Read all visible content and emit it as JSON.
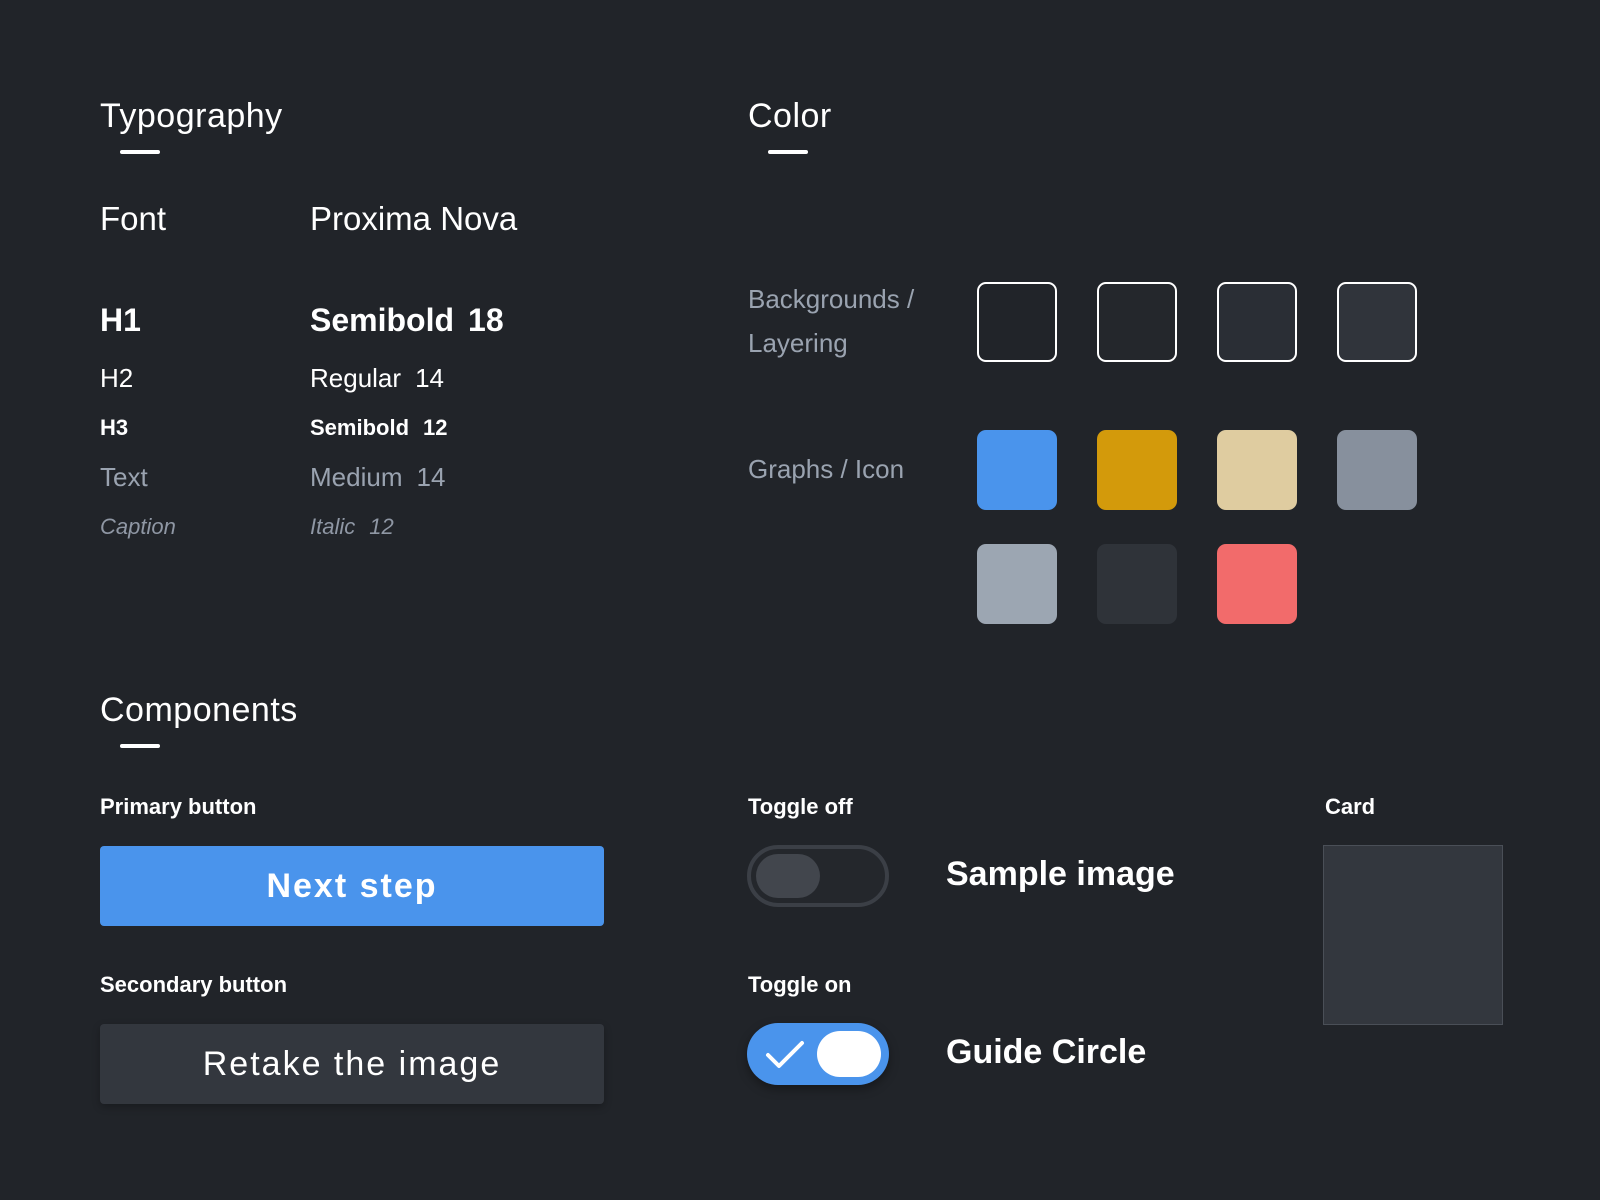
{
  "typography": {
    "title": "Typography",
    "rows": [
      {
        "left": "Font",
        "right_a": "Proxima Nova",
        "right_b": ""
      },
      {
        "left": "H1",
        "right_a": "Semibold",
        "right_b": "18"
      },
      {
        "left": "H2",
        "right_a": "Regular",
        "right_b": "14"
      },
      {
        "left": "H3",
        "right_a": "Semibold",
        "right_b": "12"
      },
      {
        "left": "Text",
        "right_a": "Medium",
        "right_b": "14"
      },
      {
        "left": "Caption",
        "right_a": "Italic",
        "right_b": "12"
      }
    ]
  },
  "color": {
    "title": "Color",
    "backgrounds_label_1": "Backgrounds /",
    "backgrounds_label_2": "Layering",
    "backgrounds": [
      "#212429",
      "#24272c",
      "#2a2e35",
      "#30343b"
    ],
    "graphs_label": "Graphs / Icon",
    "graphs": [
      "#4a94ec",
      "#d39a0b",
      "#dfcca0",
      "#87909d",
      "#9ca6b2",
      "#2f3339",
      "#f26b6b"
    ]
  },
  "components": {
    "title": "Components",
    "primary_label": "Primary button",
    "primary_text": "Next step",
    "secondary_label": "Secondary button",
    "secondary_text": "Retake the image",
    "toggle_off_label": "Toggle off",
    "toggle_off_text": "Sample image",
    "toggle_on_label": "Toggle on",
    "toggle_on_text": "Guide Circle",
    "card_label": "Card"
  }
}
